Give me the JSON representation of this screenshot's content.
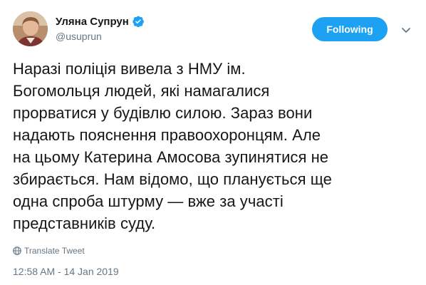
{
  "author": {
    "display_name": "Уляна Супрун",
    "handle": "@usuprun",
    "verified": true
  },
  "follow_button": {
    "label": "Following"
  },
  "icons": {
    "avatar": "avatar-photo",
    "verified": "verified-badge-icon",
    "caret": "chevron-down-icon",
    "translate": "globe-icon"
  },
  "colors": {
    "accent": "#1da1f2",
    "text": "#14171a",
    "muted": "#657786"
  },
  "tweet": {
    "lines": [
      "Наразі поліція вивела з НМУ ім.",
      "Богомольця людей, які намагалися",
      "прорватися у будівлю силою. Зараз вони",
      "надають пояснення правоохоронцям. Але",
      "на цьому Катерина Амосова зупинятися не",
      "збирається. Нам відомо, що планується ще",
      "одна спроба штурму — вже за участі",
      "представників суду."
    ],
    "translate_label": "Translate Tweet",
    "timestamp": "12:58 AM - 14 Jan 2019"
  }
}
